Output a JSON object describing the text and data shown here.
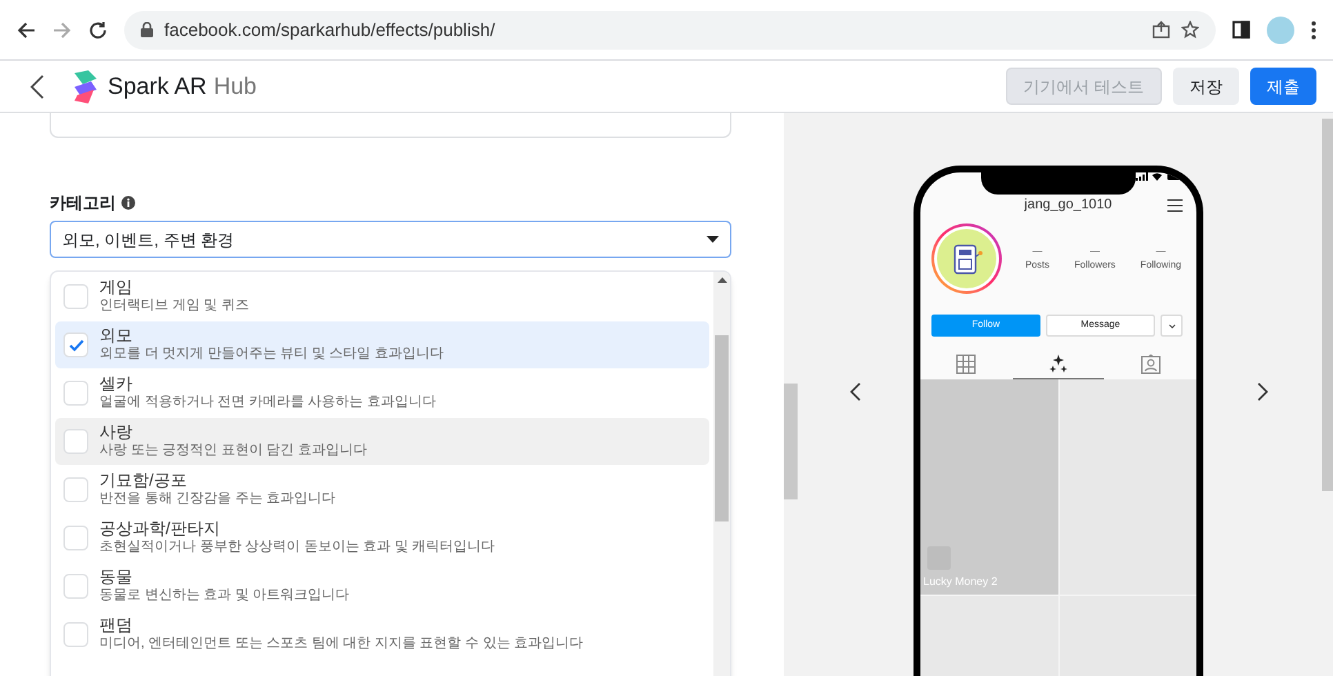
{
  "browser": {
    "url": "facebook.com/sparkarhub/effects/publish/"
  },
  "header": {
    "logo": "Spark AR",
    "logo_suffix": "Hub",
    "buttons": [
      {
        "label": "기기에서 테스트",
        "kind": "disabled"
      },
      {
        "label": "저장",
        "kind": "secondary"
      },
      {
        "label": "제출",
        "kind": "primary"
      }
    ]
  },
  "category": {
    "label": "카테고리",
    "value": "외모, 이벤트, 주변 환경"
  },
  "options": [
    {
      "title": "게임",
      "description": "인터랙티브 게임 및 퀴즈",
      "checked": false,
      "highlighted": false
    },
    {
      "title": "외모",
      "description": "외모를 더 멋지게 만들어주는 뷰티 및 스타일 효과입니다",
      "checked": true,
      "highlighted": false
    },
    {
      "title": "셀카",
      "description": "얼굴에 적용하거나 전면 카메라를 사용하는 효과입니다",
      "checked": false,
      "highlighted": false
    },
    {
      "title": "사랑",
      "description": "사랑 또는 긍정적인 표현이 담긴 효과입니다",
      "checked": false,
      "highlighted": true
    },
    {
      "title": "기묘함/공포",
      "description": "반전을 통해 긴장감을 주는 효과입니다",
      "checked": false,
      "highlighted": false
    },
    {
      "title": "공상과학/판타지",
      "description": "초현실적이거나 풍부한 상상력이 돋보이는 효과 및 캐릭터입니다",
      "checked": false,
      "highlighted": false
    },
    {
      "title": "동물",
      "description": "동물로 변신하는 효과 및 아트워크입니다",
      "checked": false,
      "highlighted": false
    },
    {
      "title": "팬덤",
      "description": "미디어, 엔터테인먼트 또는 스포츠 팀에 대한 지지를 표현할 수 있는 효과입니다",
      "checked": false,
      "highlighted": false
    }
  ],
  "preview": {
    "username": "jang_go_1010",
    "stats": [
      {
        "count": "—",
        "label": "Posts"
      },
      {
        "count": "—",
        "label": "Followers"
      },
      {
        "count": "—",
        "label": "Following"
      }
    ],
    "follow": "Follow",
    "message": "Message",
    "tabs": [
      {
        "kind": "grid",
        "selected": false
      },
      {
        "kind": "effects",
        "selected": true
      },
      {
        "kind": "tagged",
        "selected": false
      }
    ],
    "posts": [
      {
        "kind": "effect",
        "title": "Lucky Money 2"
      },
      {
        "kind": "empty"
      },
      {
        "kind": "empty"
      },
      {
        "kind": "empty"
      }
    ]
  }
}
